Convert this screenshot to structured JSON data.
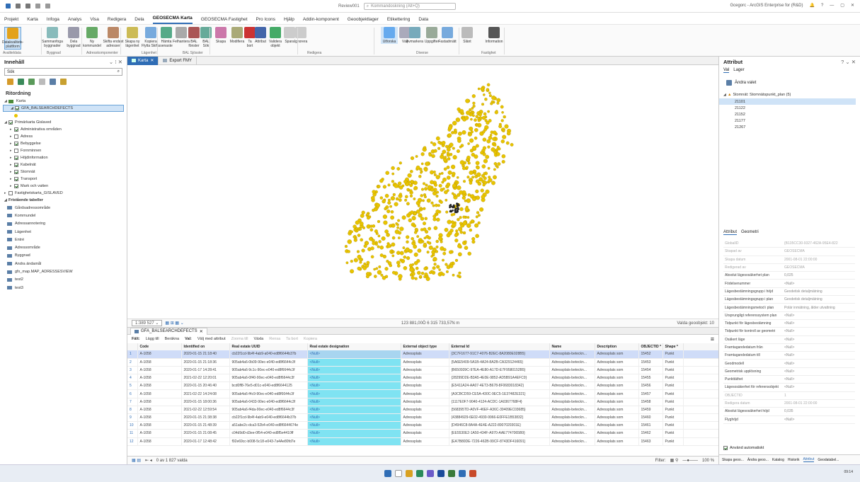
{
  "titlebar": {
    "project_name": "Review001",
    "search_placeholder": "Kommandoskning (Alt+Q)",
    "user": "Gcegorc - ArcGIS Enterprise for (R&D)"
  },
  "main_tabs": [
    "Projekt",
    "Karta",
    "Infoga",
    "Analys",
    "Visa",
    "Redigera",
    "Dela",
    "GEOSECMA Karta",
    "GEOSECMA Fastighet",
    "Pro Icons",
    "Hjälp",
    "Addin-komponent",
    "Geoobjektlager",
    "Etikettering",
    "Data"
  ],
  "active_tab": "GEOSECMA Karta",
  "ribbon": {
    "buttons": [
      {
        "label": "Datakvalitets-\nplattform"
      },
      {
        "label": "Sammanfoga\nbyggnader"
      },
      {
        "label": "Dela\nbyggnad"
      },
      {
        "label": "Ny\nkommundel"
      },
      {
        "label": "Skifta endast\nadresser"
      },
      {
        "label": "Skapa ny\nlägenhet"
      },
      {
        "label": "Kopiera\nFlytta Skifta"
      },
      {
        "label": "Hämta\nsenaste"
      },
      {
        "label": "Felhantera"
      },
      {
        "label": "BAL\nfönster"
      },
      {
        "label": "BAL\nSök"
      },
      {
        "label": "Skapa"
      },
      {
        "label": "Modifiera"
      },
      {
        "label": "Ta\nbort"
      },
      {
        "label": "Attribut"
      },
      {
        "label": "Validera\nobjekt"
      },
      {
        "label": "Spara"
      },
      {
        "label": "Ignorera"
      },
      {
        "label": "Utforska"
      },
      {
        "label": "Välj"
      },
      {
        "label": "Avmarkera"
      },
      {
        "label": "Uppgifter"
      },
      {
        "label": "Fastadrnätt"
      },
      {
        "label": "Slänt"
      },
      {
        "label": "Information"
      }
    ],
    "groups": [
      "Avaliteldata",
      "Byggnad",
      "Adresskomponenter",
      "Lägenhet",
      "BAL Sjösster",
      "Redigera",
      "Diverse",
      "Fastighet"
    ]
  },
  "contents": {
    "title": "Innehåll",
    "search_value": "Sök",
    "section": "Ritordning",
    "map_name": "Karta",
    "selected_layer": "GFA_BALSEARCHDEFECTS",
    "group_layer": "Primärkarta Gislaved",
    "layers": [
      {
        "name": "Administrativa områden",
        "on": true
      },
      {
        "name": "Adress",
        "on": false
      },
      {
        "name": "Bebyggelse",
        "on": true
      },
      {
        "name": "Fornminnen",
        "on": false
      },
      {
        "name": "Höjdinformation",
        "on": true
      },
      {
        "name": "Kabelnät",
        "on": true
      },
      {
        "name": "Stomnät",
        "on": true
      },
      {
        "name": "Transport",
        "on": true
      },
      {
        "name": "Mark och vatten",
        "on": true
      }
    ],
    "other_group": "Fastighetskarta_GISLAVED",
    "tables_section": "Fristående tabeller",
    "tables": [
      "Gårdsadressområde",
      "Kommundel",
      "Adressannotering",
      "Lägenhet",
      "Entré",
      "Adressområde",
      "Byggnad",
      "Andra ändamål",
      "gfx_map.MAP_ADRESSESVIEW",
      "test2",
      "test3"
    ]
  },
  "view_tabs": [
    {
      "label": "Karta"
    },
    {
      "label": "Export FMY"
    }
  ],
  "map_status": {
    "scale": "1:389 527",
    "coords": "123 881,00Ö 6 315 733,57N m",
    "selected": "Valda geoobjekt: 10"
  },
  "table": {
    "tab": "GFA_BALSEARCHDEFECTS",
    "toolbar": [
      "Fält:",
      "Lägg till",
      "Beräkna",
      "Val:",
      "Välj med attribut",
      "Zooma till",
      "Växla",
      "Rensa",
      "Ta bort",
      "Kopiera"
    ],
    "columns": [
      "Code",
      "Identified on",
      "Real estate UUID",
      "Real estate designation",
      "External object type",
      "External Id",
      "Name",
      "Description",
      "OBJECTID *",
      "Shape *"
    ],
    "rows": [
      [
        "1",
        "A-1058",
        "2020-01-15 21:18:40",
        "cb22f1cd-9b4f-4ab9-a040-ed8f6644b37b",
        "<Null>",
        "Adressplats",
        "{3C7F1677-91C7-4076-B2EC-8A2080E028B5}",
        "Adressplats-beteckn...",
        "Adressplats som",
        "15452",
        "Punkt"
      ],
      [
        "2",
        "A-1058",
        "2020-01-15 21:18:36",
        "905ab4a6-0b09-90ec-e040-ed8f6644c3f",
        "<Null>",
        "Adressplats",
        "{5A6E5409-5A1B-4A24-8A2B-CA329124465}",
        "Adressplats-beteckn...",
        "Adressplats som",
        "15453",
        "Punkt"
      ],
      [
        "3",
        "A-1058",
        "2020-01-17 14:28:41",
        "905ab4a6-9c1c-90ec-e040-ed8f6644c3f",
        "<Null>",
        "Adressplats",
        "{B650939C-97EA-4E80-A17D-E7F9580152B5}",
        "Adressplats-beteckn...",
        "Adressplats som",
        "15454",
        "Punkt"
      ],
      [
        "4",
        "A-1058",
        "2021-02-22 12:20:01",
        "905ab4a6-0f40-90ec-e040-ed8f6644c3f",
        "<Null>",
        "Adressplats",
        "{28299D2E-B3A5-4E0E-9852-AD5B91A4EFC0}",
        "Adressplats-beteckn...",
        "Adressplats som",
        "15455",
        "Punkt"
      ],
      [
        "5",
        "A-1058",
        "2020-01-15 20:46:40",
        "bcd0ff8-76e5-d01c-e040-ed8f6644125",
        "<Null>",
        "Adressplats",
        "{E5411A24-AA07-4ET3-B678-8F0683018342}",
        "Adressplats-beteckn...",
        "Adressplats som",
        "15456",
        "Punkt"
      ],
      [
        "6",
        "A-1058",
        "2021-02-22 14:24:08",
        "905ab4a6-f4c9-90ec-e040-ed8f6644c3f",
        "<Null>",
        "Adressplats",
        "{A3CBCD59-CE5A-430C-9EC5-1E37482E321}",
        "Adressplats-beteckn...",
        "Adressplats som",
        "15457",
        "Punkt"
      ],
      [
        "7",
        "A-1058",
        "2020-01-15 18:00:36",
        "905ab4a6-0433-90ec-e040-ed8f6644c3f",
        "<Null>",
        "Adressplats",
        "{1117E0F7-9040-4124-ACDC-1A0367768F4}",
        "Adressplats-beteckn...",
        "Adressplats som",
        "15458",
        "Punkt"
      ],
      [
        "8",
        "A-1058",
        "2021-02-22 12:59:54",
        "905ab4a6-f4da-90ec-e040-ed8f6644c3f",
        "<Null>",
        "Adressplats",
        "{568395TD-A0VF-46EF-A36C-39409EC03685}",
        "Adressplats-beteckn...",
        "Adressplats som",
        "15459",
        "Punkt"
      ],
      [
        "9",
        "A-1058",
        "2020-01-15 21:38:38",
        "cb22f1cd-9b4f-4ab9-e040-ed8f6644b37b",
        "<Null>",
        "Adressplats",
        "{43884929-6E02-4930-9966-E0FFE1B53832}",
        "Adressplats-beteckn...",
        "Adressplats som",
        "15460",
        "Punkt"
      ],
      [
        "10",
        "A-1058",
        "2020-01-15 21:48:39",
        "a51abe2c-dca3-52b4-e040-ed8f6644674e",
        "<Null>",
        "Adressplats",
        "{D4946C8-8A4A-4E4E-A222-8907020301E}",
        "Adressplats-beteckn...",
        "Adressplats som",
        "15461",
        "Punkt"
      ],
      [
        "11",
        "A-1058",
        "2020-01-15 21:08:45",
        "c04d9d0-d3ee-0f54-e040-ed8f5e4410ff",
        "<Null>",
        "Adressplats",
        "{EE5530E2-1A50-434F-A970-AAE7747065B9}",
        "Adressplats-beteckn...",
        "Adressplats som",
        "15462",
        "Punkt"
      ],
      [
        "12",
        "A-1058",
        "2020-01-17 12:48:42",
        "f92e69cc-b008-5c18-e043-7a4Ae80fd7e",
        "<Null>",
        "Adressplats",
        "{EA7B80DE-7226-462B-99CF-8743DF416091}",
        "Adressplats-beteckn...",
        "Adressplats som",
        "15463",
        "Punkt"
      ]
    ],
    "footer": "0 av 1 827 valda",
    "filter_label": "Filter:",
    "zoom": "100 %"
  },
  "attributes": {
    "title": "Attribut",
    "subtabs": [
      "Val",
      "Lager"
    ],
    "change_selection": "Ändra valet",
    "layer_node": "Stomnät: Stomnätspunkt_plan (5)",
    "ids": [
      "21101",
      "21122",
      "21152",
      "21177",
      "21267"
    ],
    "attr_tabs": [
      "Attribut",
      "Geometri"
    ],
    "rows": [
      {
        "k": "GlobalID",
        "v": "{B135CC30-9327-462A-95E4-822",
        "grey": true
      },
      {
        "k": "Skapad av",
        "v": "GEOSECMA",
        "grey": true
      },
      {
        "k": "Skapa datum",
        "v": "2001-08-01 22:00:00",
        "grey": true
      },
      {
        "k": "Redigerad av",
        "v": "GEOSECMA",
        "grey": true
      },
      {
        "k": "Absolut lägesosäkerhet plan",
        "v": "0,025"
      },
      {
        "k": "Födelsenummer",
        "v": "<Null>"
      },
      {
        "k": "Lägesbestämningsgrupp i höjd",
        "v": "Geodetisk detaljmätning"
      },
      {
        "k": "Lägesbestämningsgrupp i plan",
        "v": "Geodetisk detaljmätning"
      },
      {
        "k": "Lägesbestämningsmetod i plan",
        "v": "Polär inmätning, ålder utvattning"
      },
      {
        "k": "Ursprungligt referenssystem plan",
        "v": "<Null>"
      },
      {
        "k": "Tidpunkt för lägesbestämning",
        "v": "<Null>"
      },
      {
        "k": "Tidpunkt för kontroll av geometri",
        "v": "<Null>"
      },
      {
        "k": "Osäkert läge",
        "v": "<Null>"
      },
      {
        "k": "Framtagandedatum från",
        "v": "<Null>"
      },
      {
        "k": "Framtagandedatum till",
        "v": "<Null>"
      },
      {
        "k": "Geodmodell",
        "v": "<Null>"
      },
      {
        "k": "Geometrisk upplösning",
        "v": "<Null>"
      },
      {
        "k": "Punkttäthet",
        "v": "<Null>"
      },
      {
        "k": "Lägesosäkerhet för referensobjekt",
        "v": "<Null>"
      },
      {
        "k": "OBJECTID",
        "v": "1",
        "grey": true
      },
      {
        "k": "Redigera datum",
        "v": "2001-08-01 22:00:00",
        "grey": true
      },
      {
        "k": "Absolut lägesosäkerhet höjd",
        "v": "0,035"
      },
      {
        "k": "Flyghöjd",
        "v": "<Null>"
      }
    ],
    "auto_apply": "Använd automatiskt",
    "bottom_tabs": [
      "Skapa geoo...",
      "Ändra geoo...",
      "Katalog",
      "Historik",
      "Attribut",
      "Geodatabel..."
    ]
  },
  "taskbar": {
    "clock": "09:14"
  },
  "colors": {
    "accent": "#2f6db5",
    "points": "#e8c400",
    "cyan": "#7fe3f2"
  }
}
